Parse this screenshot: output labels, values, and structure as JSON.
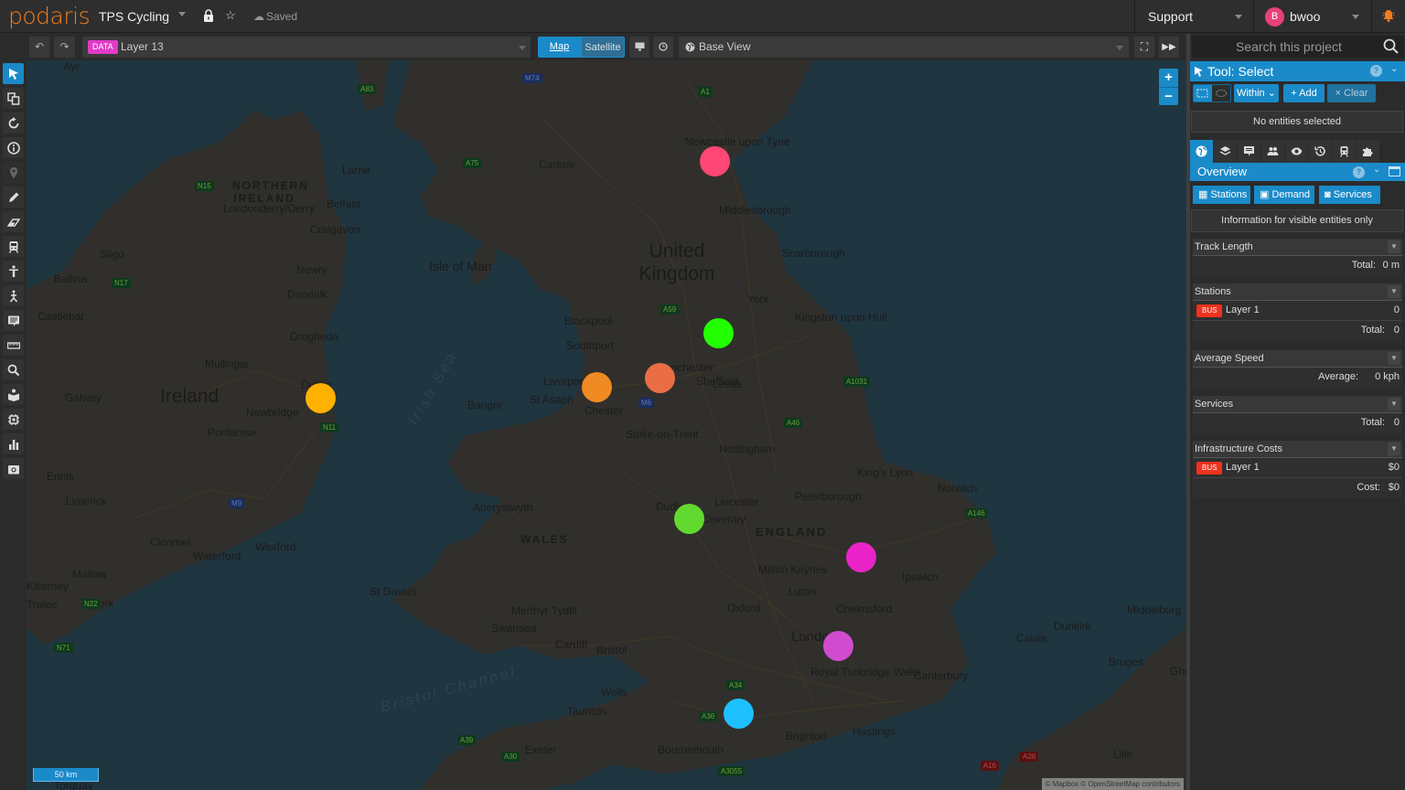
{
  "app": {
    "logo": "podaris",
    "project_title": "TPS Cycling",
    "save_status": "Saved",
    "support_label": "Support",
    "user": {
      "initial": "B",
      "name": "bwoo"
    }
  },
  "toolbar": {
    "layer_badge": "DATA",
    "layer_name": "Layer 13",
    "map_mode_options": [
      "Map",
      "Satellite"
    ],
    "map_mode_selected": "Map",
    "view_name": "Base View"
  },
  "left_tools": [
    {
      "name": "select-tool",
      "icon": "cursor-icon",
      "active": true
    },
    {
      "name": "copy-tool",
      "icon": "copy-icon"
    },
    {
      "name": "rotate-tool",
      "icon": "rotate-icon"
    },
    {
      "name": "info-tool",
      "icon": "info-icon"
    },
    {
      "name": "pin-tool",
      "icon": "map-pin-icon",
      "disabled": true
    },
    {
      "name": "draw-tool",
      "icon": "pencil-icon"
    },
    {
      "name": "erase-tool",
      "icon": "eraser-icon"
    },
    {
      "name": "transit-tool",
      "icon": "train-icon"
    },
    {
      "name": "person-tool",
      "icon": "person-icon"
    },
    {
      "name": "walk-tool",
      "icon": "walking-icon"
    },
    {
      "name": "comment-tool",
      "icon": "comment-icon"
    },
    {
      "name": "measure-tool",
      "icon": "ruler-icon"
    },
    {
      "name": "search-tool",
      "icon": "search-icon"
    },
    {
      "name": "story-tool",
      "icon": "book-reader-icon"
    },
    {
      "name": "chip-tool",
      "icon": "chip-icon"
    },
    {
      "name": "chart-tool",
      "icon": "bar-chart-icon"
    },
    {
      "name": "screenshot-tool",
      "icon": "camera-icon"
    }
  ],
  "map": {
    "labels": {
      "uk": "United Kingdom",
      "ireland": "Ireland",
      "isle_of_man": "Isle of Man",
      "northern_ireland": "NORTHERN IRELAND",
      "england": "ENGLAND",
      "wales": "WALES",
      "irish_sea": "Irish Sea",
      "bristol_channel": "Bristol Channel"
    },
    "cities": [
      "Londonderry/Derry",
      "Belfast",
      "Larne",
      "Craigavon",
      "Newry",
      "Dundalk",
      "Drogheda",
      "Sligo",
      "Ballina",
      "Castlebar",
      "Mullingar",
      "Dublin",
      "Galway",
      "Newbridge",
      "Portlaoise",
      "Ennis",
      "Limerick",
      "Clonmel",
      "Waterford",
      "Wexford",
      "Mallow",
      "Killarney",
      "Cork",
      "Tralee",
      "Ayr",
      "Carlisle",
      "Newcastle upon Tyne",
      "Middlesbrough",
      "Scarborough",
      "York",
      "Kingston upon Hull",
      "Blackpool",
      "Southport",
      "Liverpool",
      "Manchester",
      "Leeds",
      "Sheffield",
      "St Asaph",
      "Chester",
      "Bangor",
      "Stoke-on-Trent",
      "Nottingham",
      "Leicester",
      "King's Lynn",
      "Norwich",
      "Peterborough",
      "Dudley",
      "Coventry",
      "Aberystwyth",
      "St Davids",
      "Merthyr Tydfil",
      "Swansea",
      "Cardiff",
      "Bristol",
      "Wells",
      "Milton Keynes",
      "Luton",
      "Oxford",
      "Chelmsford",
      "Ipswich",
      "London",
      "Royal Tunbridge Wells",
      "Canterbury",
      "Taunton",
      "Exeter",
      "Bournemouth",
      "Brighton",
      "Hastings",
      "Torquay",
      "Calais",
      "Dunkirk",
      "Bruges",
      "Ghent",
      "Middelburg",
      "Lille"
    ],
    "roads": [
      "A83",
      "M74",
      "A1",
      "A75",
      "N15",
      "N17",
      "A59",
      "M6",
      "A1031",
      "A46",
      "N11",
      "M9",
      "N22",
      "N71",
      "A146",
      "A36",
      "A34",
      "A39",
      "A30",
      "A3055",
      "A16",
      "A26"
    ],
    "markers": [
      {
        "name": "Newcastle",
        "color": "#ff4674"
      },
      {
        "name": "Leeds",
        "color": "#22ff00"
      },
      {
        "name": "Manchester",
        "color": "#ea6e45"
      },
      {
        "name": "Liverpool",
        "color": "#f08a22"
      },
      {
        "name": "Dublin",
        "color": "#ffb100"
      },
      {
        "name": "Birmingham",
        "color": "#62d92e"
      },
      {
        "name": "Cambridge",
        "color": "#e824c8"
      },
      {
        "name": "London",
        "color": "#d14bcf"
      },
      {
        "name": "Southampton",
        "color": "#1ec1ff"
      }
    ],
    "scale_label": "50 km",
    "attribution": "© Mapbox © OpenStreetMap contributors",
    "zoom_in": "+",
    "zoom_out": "−"
  },
  "panel": {
    "search_placeholder": "Search this project",
    "tool_title": "Tool: Select",
    "select_buttons": {
      "within": "Within",
      "add": "+ Add",
      "clear": "× Clear"
    },
    "no_entities": "No entities selected",
    "tabs": [
      "globe-icon",
      "layers-icon",
      "comment-icon",
      "users-icon",
      "eye-icon",
      "history-icon",
      "train-icon",
      "puzzle-icon"
    ],
    "overview_title": "Overview",
    "overview_buttons": [
      "Stations",
      "Demand",
      "Services"
    ],
    "info_text": "Information for visible entities only",
    "sections": {
      "track_length": {
        "title": "Track Length",
        "total_key": "Total:",
        "total_val": "0 m"
      },
      "stations": {
        "title": "Stations",
        "badge": "BUS",
        "layer": "Layer 1",
        "layer_val": "0",
        "total_key": "Total:",
        "total_val": "0"
      },
      "avg_speed": {
        "title": "Average Speed",
        "key": "Average:",
        "val": "0 kph"
      },
      "services": {
        "title": "Services",
        "total_key": "Total:",
        "total_val": "0"
      },
      "infra_costs": {
        "title": "Infrastructure Costs",
        "badge": "BUS",
        "layer": "Layer 1",
        "layer_val": "$0",
        "cost_key": "Cost:",
        "cost_val": "$0"
      }
    }
  }
}
